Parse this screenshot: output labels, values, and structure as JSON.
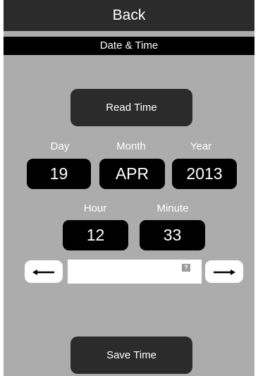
{
  "header": {
    "back_label": "Back"
  },
  "subheader": {
    "title": "Date & Time"
  },
  "buttons": {
    "read_time": "Read Time",
    "save_time": "Save Time"
  },
  "date": {
    "day_label": "Day",
    "month_label": "Month",
    "year_label": "Year",
    "day": "19",
    "month": "APR",
    "year": "2013"
  },
  "time": {
    "hour_label": "Hour",
    "minute_label": "Minute",
    "hour": "12",
    "minute": "33"
  },
  "input": {
    "value": "",
    "help_glyph": "?"
  },
  "icons": {
    "left": "arrow-left-icon",
    "right": "arrow-right-icon",
    "help": "help-icon"
  },
  "colors": {
    "background": "#acacac",
    "header": "#2b2b2b",
    "field": "#000000",
    "text": "#ffffff"
  }
}
